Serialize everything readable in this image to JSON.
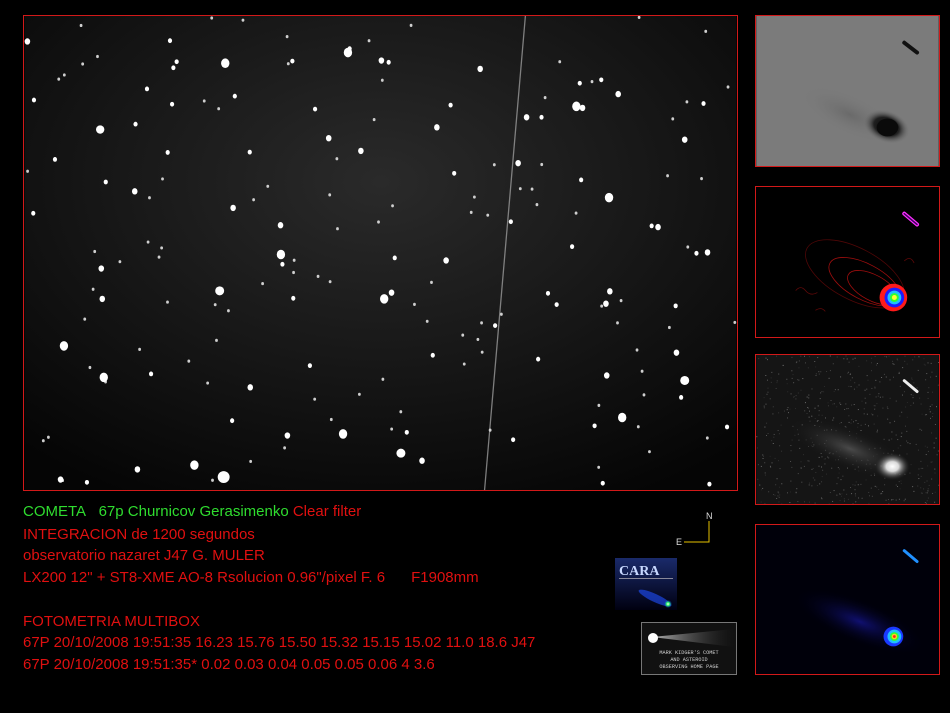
{
  "caption": {
    "line1": {
      "label": "COMETA",
      "comet": "67p Churnicov Gerasimenko",
      "filter": "Clear filter"
    },
    "line2": "INTEGRACION de 1200  segundos",
    "line3": "observatorio nazaret J47  G. MULER",
    "line4": {
      "setup": "LX200 12\" +  ST8-XME AO-8  Rsolucion 0.96\"/pixel   F. 6",
      "focal": "F1908mm"
    },
    "line5": "FOTOMETRIA MULTIBOX",
    "line6": "67P 20/10/2008 19:51:35 16.23 15.76 15.50 15.32 15.15 15.02 11.0 18.6 J47",
    "line7": "67P 20/10/2008 19:51:35* 0.02 0.03 0.04 0.05 0.05 0.06 4 3.6"
  },
  "compass": {
    "north": "N",
    "east": "E"
  },
  "cara_logo": {
    "text": "CARA"
  },
  "ridger_logo": {
    "text": [
      "MARK KIDGER'S COMET",
      "AND ASTEROID",
      "OBSERVING HOME PAGE"
    ]
  },
  "colors": {
    "border": "#d21919",
    "green_text": "#2fdc2f",
    "red_text": "#e01010"
  }
}
